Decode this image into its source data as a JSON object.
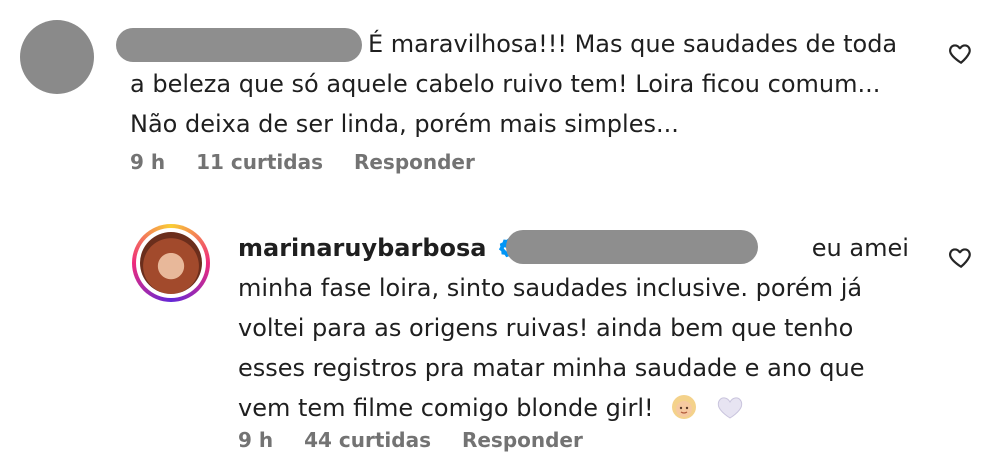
{
  "comment": {
    "text_line1": "É maravilhosa!!! Mas que saudades de toda",
    "text_line2": "a beleza que só aquele cabelo ruivo tem! Loira ficou comum...",
    "text_line3": "Não deixa de ser linda, porém mais simples...",
    "time": "9 h",
    "likes": "11 curtidas",
    "reply": "Responder"
  },
  "reply": {
    "username": "marinaruybarbosa",
    "text_line1": "eu amei",
    "text_line2": "minha fase loira, sinto saudades inclusive. porém já",
    "text_line3": "voltei para as origens ruivas! ainda bem que tenho",
    "text_line4": "esses registros pra matar minha saudade e ano que",
    "text_line5": "vem tem filme comigo blonde girl!",
    "time": "9 h",
    "likes": "44 curtidas",
    "reply": "Responder",
    "emojis": [
      "blonde-person-emoji",
      "white-heart-emoji"
    ]
  },
  "colors": {
    "verified": "#0095f6",
    "meta": "#737373",
    "redact": "#8e8e8e"
  }
}
